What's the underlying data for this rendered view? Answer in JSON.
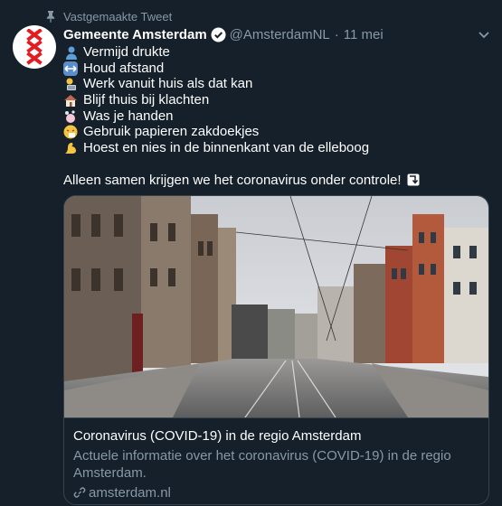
{
  "pinned": {
    "label": "Vastgemaakte Tweet",
    "icon": "pin-icon"
  },
  "author": {
    "name": "Gemeente Amsterdam",
    "handle": "@AmsterdamNL",
    "separator": "·",
    "date": "11 mei",
    "verified": true
  },
  "tweet": {
    "lines": [
      {
        "icon": "person-icon",
        "text": "Vermijd drukte"
      },
      {
        "icon": "left-right-arrow-icon",
        "text": "Houd afstand"
      },
      {
        "icon": "person-at-laptop-icon",
        "text": "Werk vanuit huis als dat kan"
      },
      {
        "icon": "house-icon",
        "text": "Blijf thuis bij klachten"
      },
      {
        "icon": "washing-hands-icon",
        "text": "Was je handen"
      },
      {
        "icon": "sneezing-face-icon",
        "text": "Gebruik papieren zakdoekjes"
      },
      {
        "icon": "flexed-biceps-icon",
        "text": "Hoest en nies in de binnenkant van de elleboog"
      }
    ],
    "closing": "Alleen samen krijgen we het coronavirus onder controle!",
    "closing_icon": "down-right-arrow-icon"
  },
  "card": {
    "title": "Coronavirus (COVID-19) in de regio Amsterdam",
    "description": "Actuele informatie over het coronavirus (COVID-19) in de regio Amsterdam.",
    "domain": "amsterdam.nl",
    "image": "empty-amsterdam-street-photo"
  },
  "colors": {
    "background": "#15202b",
    "secondary_text": "#8899a6",
    "border": "#38444d",
    "logo_red": "#e31b23"
  }
}
